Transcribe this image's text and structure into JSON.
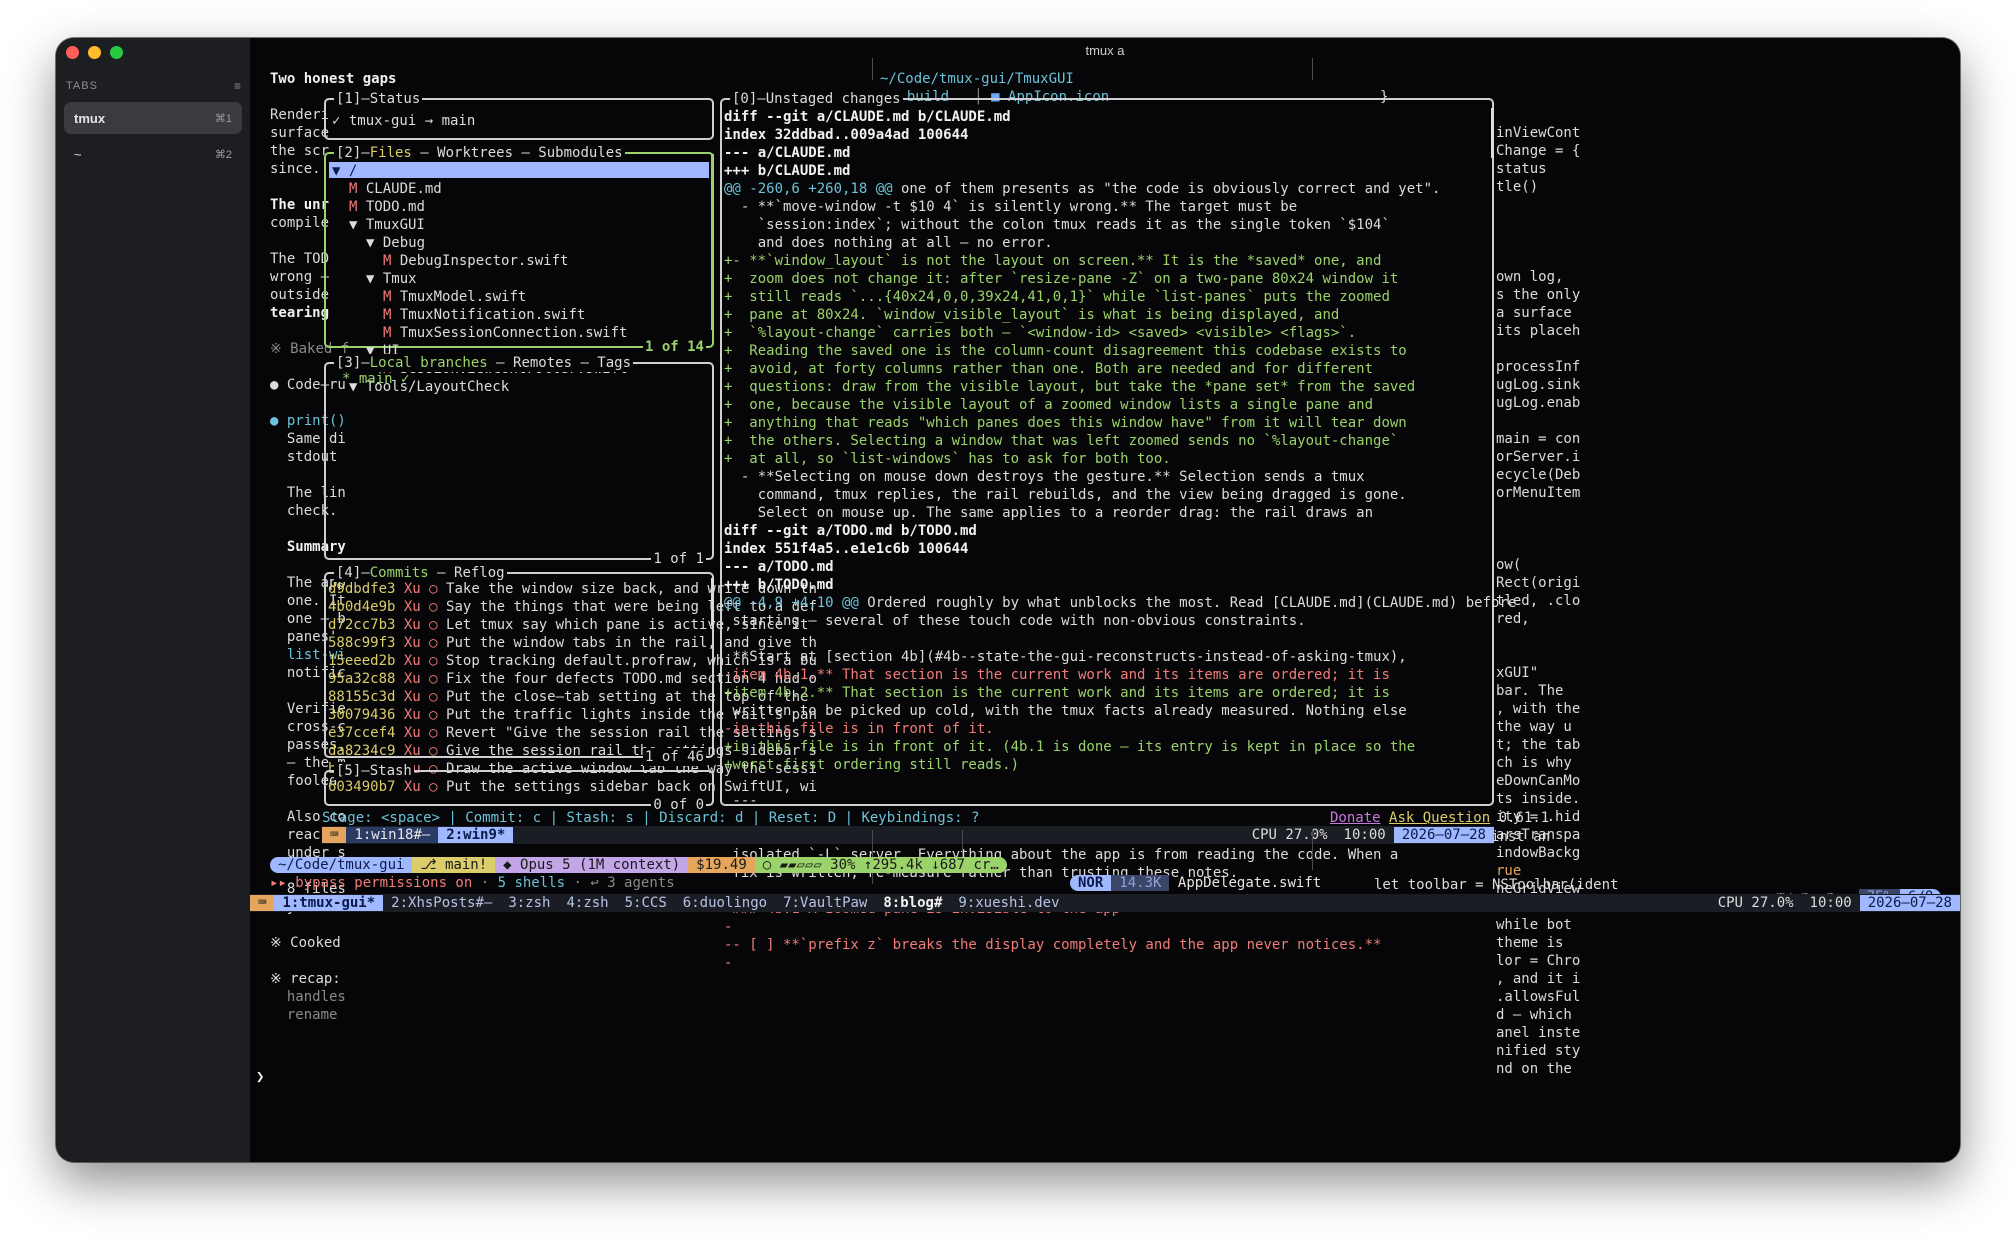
{
  "window": {
    "title": "tmux a"
  },
  "sidebar": {
    "header": "TABS",
    "tabs": [
      {
        "label": "tmux",
        "shortcut": "⌘1"
      },
      {
        "label": "~",
        "shortcut": "⌘2"
      }
    ]
  },
  "left_pane": {
    "lines": [
      "Two honest gaps",
      "",
      "Renderi",
      "surface",
      "the scr",
      "since.",
      "",
      "The unr",
      "compile",
      "",
      "The TOD",
      "wrong –",
      "outside",
      "tearing",
      "",
      "※ Baked f",
      "",
      "● Code–ru",
      "",
      "● print()",
      "  Same di",
      "  stdout",
      "",
      "  The lin",
      "  check.",
      "",
      "  Summary",
      "",
      "  The app",
      "  one. It",
      "  one – b",
      "  panes'",
      "  list-wi",
      "  notific",
      "",
      "  Verifie",
      "  cross-c",
      "  passes,",
      "  – the m",
      "  fooled",
      "",
      "  Also co",
      "  reached",
      "  under s",
      "",
      "  8 files",
      "  you wan",
      "",
      "※ Cooked",
      "",
      "※ recap:",
      "  handles",
      "  rename"
    ],
    "prompt": "❯"
  },
  "top_right": {
    "path": "~/Code/tmux-gui/TmuxGUI",
    "folders": [
      "build",
      "AppIcon.icon"
    ],
    "brace": "}"
  },
  "right_pane": {
    "lines": [
      "inViewCont",
      "Change = {",
      "status",
      "tle()",
      "",
      "",
      "",
      "",
      "own log,",
      "s the only",
      "a surface",
      "its placeh",
      "",
      "processInf",
      "ugLog.sink",
      "ugLog.enab",
      "",
      "main = con",
      "orServer.i",
      "ecycle(Deb",
      "orMenuItem",
      "",
      "",
      "",
      "ow(",
      "Rect(origi",
      "tled, .clo",
      "red,",
      "",
      "",
      "xGUI\"",
      "bar. The",
      ", with the",
      "the way u",
      "t; the tab",
      "ch is why",
      "eDownCanMo",
      "ts inside.",
      "ity = .hid",
      "arsTranspa",
      "indowBackg",
      "rue",
      "neGridView",
      "n bounds o",
      "while bot",
      "theme is",
      "lor = Chro",
      ", and it i",
      ".allowsFul",
      "d – which",
      "anel inste",
      "nified sty",
      "nd on the"
    ],
    "bottom_lines": [
      "let toolbar = NSToolbar(ident",
      "toolbar.showsBaselineSeparato"
    ]
  },
  "lazygit": {
    "status": {
      "title": "[1]–Status",
      "text": "✓ tmux-gui → main"
    },
    "files": {
      "title_num": "[2]–",
      "title_active": "Files",
      "title_rest": " – Worktrees – Submodules",
      "footer": "1 of 14",
      "tree": [
        {
          "indent": 0,
          "kind": "dir",
          "text": "▼ /"
        },
        {
          "indent": 1,
          "kind": "file",
          "mark": "M",
          "text": "CLAUDE.md"
        },
        {
          "indent": 1,
          "kind": "file",
          "mark": "M",
          "text": "TODO.md"
        },
        {
          "indent": 1,
          "kind": "dir",
          "text": "▼ TmuxGUI"
        },
        {
          "indent": 2,
          "kind": "dir",
          "text": "▼ Debug"
        },
        {
          "indent": 3,
          "kind": "file",
          "mark": "M",
          "text": "DebugInspector.swift"
        },
        {
          "indent": 2,
          "kind": "dir",
          "text": "▼ Tmux"
        },
        {
          "indent": 3,
          "kind": "file",
          "mark": "M",
          "text": "TmuxModel.swift"
        },
        {
          "indent": 3,
          "kind": "file",
          "mark": "M",
          "text": "TmuxNotification.swift"
        },
        {
          "indent": 3,
          "kind": "file",
          "mark": "M",
          "text": "TmuxSessionConnection.swift"
        },
        {
          "indent": 2,
          "kind": "dir",
          "text": "▼ UI"
        },
        {
          "indent": 3,
          "kind": "file",
          "mark": "M",
          "text": "SessionViewController.swift"
        },
        {
          "indent": 1,
          "kind": "dir",
          "text": "▼ Tools/LayoutCheck"
        }
      ]
    },
    "branches": {
      "title_num": "[3]–",
      "title_active": "Local branches",
      "title_rest": " – Remotes – Tags",
      "item": "* main ✓",
      "footer": "1 of 1"
    },
    "commits": {
      "title_num": "[4]–",
      "title_active": "Commits",
      "title_rest": " – Reflog",
      "footer": "1 of 46",
      "rows": [
        {
          "hash": "d9dbdfe3",
          "author": "Xu",
          "msg": "Take the window size back, and write down th"
        },
        {
          "hash": "4b0d4e9b",
          "author": "Xu",
          "msg": "Say the things that were being left to a def"
        },
        {
          "hash": "d72cc7b3",
          "author": "Xu",
          "msg": "Let tmux say which pane is active, since it"
        },
        {
          "hash": "588c99f3",
          "author": "Xu",
          "msg": "Put the window tabs in the rail, and give th"
        },
        {
          "hash": "15eeed2b",
          "author": "Xu",
          "msg": "Stop tracking default.profraw, which is a bu"
        },
        {
          "hash": "95a32c88",
          "author": "Xu",
          "msg": "Fix the four defects TODO.md section 4 had o"
        },
        {
          "hash": "88155c3d",
          "author": "Xu",
          "msg": "Put the close–tab setting at the top of the"
        },
        {
          "hash": "30079436",
          "author": "Xu",
          "msg": "Put the traffic lights inside the rail's pan"
        },
        {
          "hash": "e37ccef4",
          "author": "Xu",
          "msg": "Revert \"Give the session rail the settings s"
        },
        {
          "hash": "da8234c9",
          "author": "Xu",
          "msg": "Give the session rail the settings sidebar's"
        },
        {
          "hash": "b46baa34",
          "author": "Xu",
          "msg": "Draw the active window tab the way the sessi"
        },
        {
          "hash": "603490b7",
          "author": "Xu",
          "msg": "Put the settings sidebar back on SwiftUI, wi"
        }
      ]
    },
    "stash": {
      "title": "[5]–Stash",
      "footer": "0 of 0"
    },
    "diff": {
      "title": "[0]–Unstaged changes",
      "lines": [
        {
          "s": "b",
          "t": "diff --git a/CLAUDE.md b/CLAUDE.md"
        },
        {
          "s": "b",
          "t": "index 32ddbad..009a4ad 100644"
        },
        {
          "s": "b",
          "t": "--- a/CLAUDE.md"
        },
        {
          "s": "b",
          "t": "+++ b/CLAUDE.md"
        },
        {
          "s": "h",
          "t": "@@ -260,6 +260,18 @@",
          "rest": " one of them presents as \"the code is obviously correct and yet\"."
        },
        {
          "s": "n",
          "t": "  - **`move-window -t $10 4` is silently wrong.** The target must be"
        },
        {
          "s": "n",
          "t": "    `session:index`; without the colon tmux reads it as the single token `$104`"
        },
        {
          "s": "n",
          "t": "    and does nothing at all – no error."
        },
        {
          "s": "a",
          "t": "+- **`window_layout` is not the layout on screen.** It is the *saved* one, and"
        },
        {
          "s": "a",
          "t": "+  zoom does not change it: after `resize-pane -Z` on a two-pane 80x24 window it"
        },
        {
          "s": "a",
          "t": "+  still reads `...{40x24,0,0,39x24,41,0,1}` while `list-panes` puts the zoomed"
        },
        {
          "s": "a",
          "t": "+  pane at 80x24. `window_visible_layout` is what is being displayed, and"
        },
        {
          "s": "a",
          "t": "+  `%layout-change` carries both – `<window-id> <saved> <visible> <flags>`."
        },
        {
          "s": "a",
          "t": "+  Reading the saved one is the column-count disagreement this codebase exists to"
        },
        {
          "s": "a",
          "t": "+  avoid, at forty columns rather than one. Both are needed and for different"
        },
        {
          "s": "a",
          "t": "+  questions: draw from the visible layout, but take the *pane set* from the saved"
        },
        {
          "s": "a",
          "t": "+  one, because the visible layout of a zoomed window lists a single pane and"
        },
        {
          "s": "a",
          "t": "+  anything that reads \"which panes does this window have\" from it will tear down"
        },
        {
          "s": "a",
          "t": "+  the others. Selecting a window that was left zoomed sends no `%layout-change`"
        },
        {
          "s": "a",
          "t": "+  at all, so `list-windows` has to ask for both too."
        },
        {
          "s": "n",
          "t": "  - **Selecting on mouse down destroys the gesture.** Selection sends a tmux"
        },
        {
          "s": "n",
          "t": "    command, tmux replies, the rail rebuilds, and the view being dragged is gone."
        },
        {
          "s": "n",
          "t": "    Select on mouse up. The same applies to a reorder drag: the rail draws an"
        },
        {
          "s": "b",
          "t": "diff --git a/TODO.md b/TODO.md"
        },
        {
          "s": "b",
          "t": "index 551f4a5..e1e1c6b 100644"
        },
        {
          "s": "b",
          "t": "--- a/TODO.md"
        },
        {
          "s": "b",
          "t": "+++ b/TODO.md"
        },
        {
          "s": "h",
          "t": "@@ -4,9 +4,10 @@",
          "rest": " Ordered roughly by what unblocks the most. Read [CLAUDE.md](CLAUDE.md) before"
        },
        {
          "s": "n",
          "t": " starting – several of these touch code with non-obvious constraints."
        },
        {
          "s": "n",
          "t": ""
        },
        {
          "s": "n",
          "t": " **Start at [section 4b](#4b--state-the-gui-reconstructs-instead-of-asking-tmux),"
        },
        {
          "s": "d",
          "t": "-item 4b.1.** That section is the current work and its items are ordered; it is"
        },
        {
          "s": "a",
          "t": "+item 4b.2.** That section is the current work and its items are ordered; it is"
        },
        {
          "s": "n",
          "t": " written to be picked up cold, with the tmux facts already measured. Nothing else"
        },
        {
          "s": "d",
          "t": "-in this file is in front of it."
        },
        {
          "s": "a",
          "t": "+in this file is in front of it. (4b.1 is done – its entry is kept in place so the"
        },
        {
          "s": "a",
          "t": "+worst-first ordering still reads.)"
        },
        {
          "s": "n",
          "t": ""
        },
        {
          "s": "n",
          "t": " ---"
        },
        {
          "s": "n",
          "t": ""
        },
        {
          "s": "h",
          "t": "@@ -131,36 +132,117 @@",
          "rest": " Everything stated about tmux below was measured on **tmux 3.6a** against an"
        },
        {
          "s": "n",
          "t": " isolated `-L` server. Everything about the app is from reading the code. When a"
        },
        {
          "s": "n",
          "t": " fix is written, re-measure rather than trusting these notes."
        },
        {
          "s": "n",
          "t": ""
        },
        {
          "s": "d",
          "t": "-### 4b.1 A zoomed pane is invisible to the app"
        },
        {
          "s": "d",
          "t": "-"
        },
        {
          "s": "d",
          "t": "-- [ ] **`prefix z` breaks the display completely and the app never notices.**"
        },
        {
          "s": "d",
          "t": "-"
        }
      ]
    },
    "keybar": {
      "hints": "Stage: <space> | Commit: c | Stash: s | Discard: d | Reset: D | Keybindings: ?",
      "donate": "Donate",
      "ask": "Ask Question",
      "version": "0.61.1"
    },
    "inner_status": {
      "win1": "1:win18#–",
      "win2": "2:win9*",
      "cpu": "CPU 27.0%",
      "time": "10:00",
      "date": "2026–07–28"
    }
  },
  "claude_status": {
    "path": "~/Code/tmux-gui",
    "branch": "⎇ main!",
    "model": "◆ Opus 5 (1M context)",
    "cost": "$19.49",
    "context": "○ ▰▰▱▱▱ 30% ↑295.4k ↓687 cr…",
    "perm": "▸▸ bypass permissions on",
    "shells": "5 shells",
    "agents": "3 agents"
  },
  "vim_status": {
    "mode": "NOR",
    "size": "14.3K",
    "file": "AppDelegate.swift",
    "perms": "-rw-r--r--",
    "pct": "75%",
    "pos": "6/8"
  },
  "tmux_status": {
    "windows": [
      "1:tmux-gui*",
      "2:XhsPosts#–",
      "3:zsh",
      "4:zsh",
      "5:CCS",
      "6:duolingo",
      "7:VaultPaw",
      "8:blog#",
      "9:xueshi.dev"
    ],
    "cpu": "CPU 27.0%",
    "time": "10:00",
    "date": "2026–07–28"
  },
  "colors": {
    "accent_green": "#9bd36b",
    "accent_blue": "#9fb8ff",
    "diff_add": "#9bd36b",
    "diff_del": "#f07c78",
    "bg": "#060608"
  }
}
